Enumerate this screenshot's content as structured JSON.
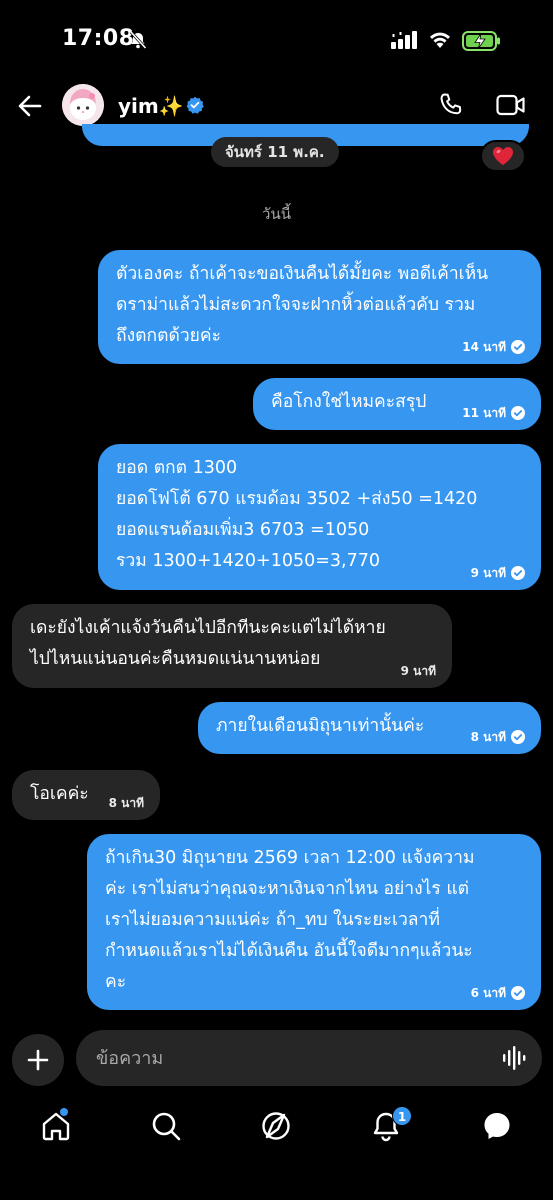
{
  "status_bar": {
    "time": "17:08"
  },
  "header": {
    "name": "yim✨"
  },
  "chat": {
    "date_separator": "จันทร์ 11 พ.ค.",
    "today_label": "วันนี้",
    "messages": [
      {
        "dir": "out",
        "lines": [
          "ตัวเองคะ ถ้าเค้าจะขอเงินคืนได้มั้ยคะ พอดีเค้าเห็น",
          "ดราม่าแล้วไม่สะดวกใจจะฝากหิ้วต่อแล้วคับ รวม",
          "ถึงตกตด้วยค่ะ"
        ],
        "time": "14 นาที"
      },
      {
        "dir": "out",
        "lines": [
          "คือโกงใช่ไหมคะสรุป"
        ],
        "time": "11 นาที"
      },
      {
        "dir": "out",
        "lines": [
          "ยอด ตกต 1300",
          "ยอดโฟโต้ 670 แรมด้อม 3502 +ส่ง50 =1420",
          "ยอดแรนด้อมเพิ่ม3 6703 =1050",
          "รวม 1300+1420+1050=3,770"
        ],
        "time": "9 นาที"
      },
      {
        "dir": "in",
        "lines": [
          "เดะยังไงเค้าแจ้งวันคืนไปอีกทีนะคะแต่ไม่ได้หาย",
          "ไปไหนแน่นอนค่ะคืนหมดแน่นานหน่อย"
        ],
        "time": "9 นาที"
      },
      {
        "dir": "out",
        "lines": [
          "ภายในเดือนมิถุนาเท่านั้นค่ะ"
        ],
        "time": "8 นาที"
      },
      {
        "dir": "in",
        "lines": [
          "โอเคค่ะ"
        ],
        "time": "8 นาที"
      },
      {
        "dir": "out",
        "lines": [
          "ถ้าเกิน30 มิถุนายน 2569 เวลา 12:00 แจ้งความ",
          "ค่ะ เราไม่สนว่าคุณจะหาเงินจากไหน อย่างไร แต่",
          "เราไม่ยอมความแน่ค่ะ ถ้า_ทบ ในระยะเวลาที่",
          "กำหนดแล้วเราไม่ได้เงินคืน อันนี้ใจดีมากๆแล้วนะ",
          "คะ"
        ],
        "time": "6 นาที"
      }
    ]
  },
  "composer": {
    "placeholder": "ข้อความ"
  },
  "nav": {
    "notification_count": "1"
  },
  "colors": {
    "accent": "#3797f0",
    "incoming": "#262626",
    "background": "#000000"
  },
  "icons": [
    "back-arrow-icon",
    "verified-badge-icon",
    "phone-icon",
    "video-camera-icon",
    "heart-icon",
    "plus-icon",
    "microphone-icon",
    "home-icon",
    "search-icon",
    "explore-icon",
    "notification-bell-icon",
    "messenger-icon"
  ]
}
